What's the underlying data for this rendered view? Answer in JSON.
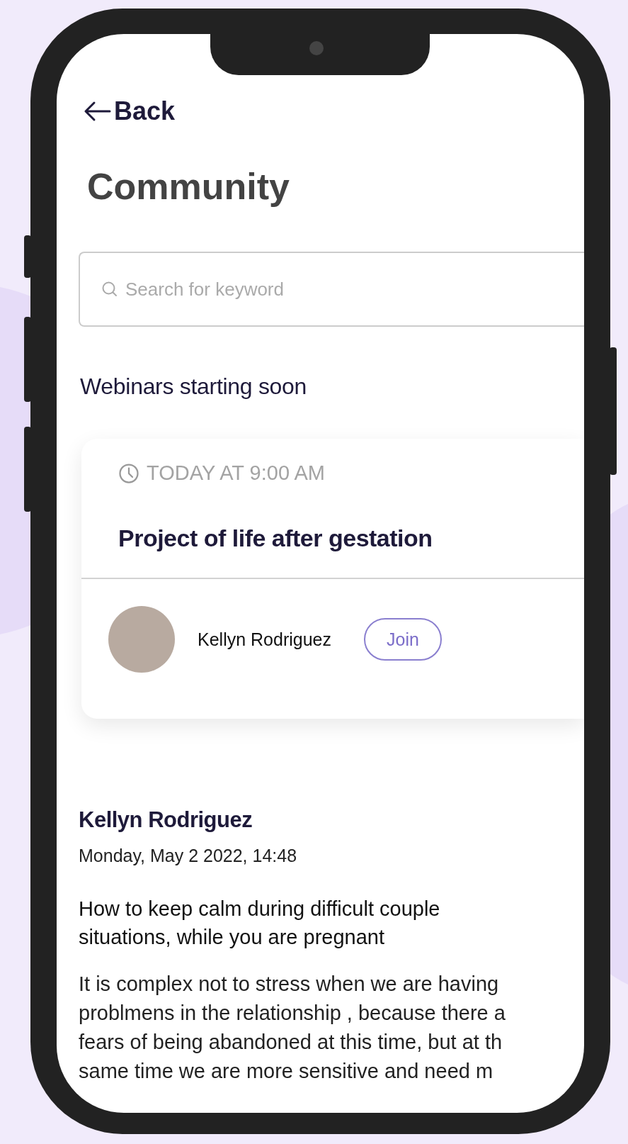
{
  "back": {
    "label": "Back"
  },
  "title": "Community",
  "search": {
    "placeholder": "Search for keyword"
  },
  "webinars": {
    "heading": "Webinars starting soon",
    "cards": [
      {
        "time": "TODAY AT 9:00 AM",
        "title": "Project of life after gestation",
        "host": "Kellyn Rodriguez",
        "action": "Join"
      }
    ]
  },
  "post": {
    "author": "Kellyn Rodriguez",
    "date": "Monday, May 2 2022, 14:48",
    "title": "How to keep calm during difficult couple situations, while you are pregnant",
    "body_lines": [
      "It is complex not to stress when we are having",
      "problmens in the relationship , because there a",
      "fears of being abandoned at this time, but at th",
      "same time we are more sensitive and need m"
    ]
  }
}
